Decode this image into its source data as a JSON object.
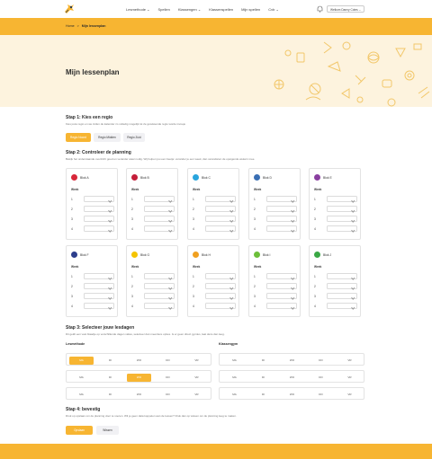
{
  "nav": {
    "items": [
      "Lesmethode ⌄",
      "Spellen",
      "Klassengen ⌄",
      "Klassenspellen",
      "Mijn spellen",
      "Cvb ⌄"
    ],
    "user_button": "Welkom Danny Cotes ⌄"
  },
  "breadcrumb": {
    "home": "Home",
    "sep": ">",
    "current": "Mijn lessenplan"
  },
  "hero": {
    "title": "Mijn lessenplan"
  },
  "step1": {
    "title": "Stap 1: Kies een regio",
    "desc": "Kies jouw regio en we zullen de kalender zo volledig mogelijk tot 2e gewissende regio worde invoeje",
    "regions": [
      "Regio Noord",
      "Regio Midden",
      "Regio Zuid"
    ],
    "active_region": 0
  },
  "step2": {
    "title": "Stap 2: Controleer de planning",
    "desc": "Bekijk het onderstaande overzicht goed en verander waar nodig. Wij helpen jou een beetje: verander je een week, dan verandaren de opeigende wekern mee.",
    "week_label": "Week",
    "weeks": [
      "1",
      "2",
      "3",
      "4"
    ],
    "blocks": [
      {
        "name": "Blok A",
        "color": "#d8283a",
        "icon": "shoe-icon"
      },
      {
        "name": "Blok B",
        "color": "#c41e3a",
        "icon": "hand-icon"
      },
      {
        "name": "Blok C",
        "color": "#29a5dd",
        "icon": "swimmer-icon"
      },
      {
        "name": "Blok D",
        "color": "#3a6fb4",
        "icon": "rings-icon"
      },
      {
        "name": "Blok E",
        "color": "#8a3fa0",
        "icon": "runner-icon"
      },
      {
        "name": "Blok F",
        "color": "#2c3e8c",
        "icon": "ball-icon"
      },
      {
        "name": "Blok G",
        "color": "#f5c400",
        "icon": "figure-icon"
      },
      {
        "name": "Blok H",
        "color": "#f0a020",
        "icon": "skate-icon"
      },
      {
        "name": "Blok I",
        "color": "#6cbf3a",
        "icon": "star-icon"
      },
      {
        "name": "Blok J",
        "color": "#3aa845",
        "icon": "horseshoe-icon"
      }
    ]
  },
  "step3": {
    "title": "Stap 3: Selecteer jouw lesdagen",
    "desc": "Dit geldt een vast blaadje op verschillende dagen valies, selecteer dan meerdere opties. Is er geen direct gymles, laat deze dan leeg.",
    "lesmethode_label": "Lesmethode",
    "klassengym_label": "Klassengym",
    "days": [
      "MA",
      "DI",
      "WO",
      "DO",
      "VR"
    ],
    "lesmethode_rows": [
      {
        "on": [
          0
        ]
      },
      {
        "on": [
          2
        ]
      },
      {
        "on": []
      }
    ],
    "klassengym_rows": [
      {
        "on": []
      },
      {
        "on": []
      },
      {
        "on": []
      }
    ]
  },
  "step4": {
    "title": "Stap 4: bevestig",
    "desc": "Druk op opslaan om de planning door te voeren. Wil je geen data koppelen aan de lessen? Druk dan op wissen om de planning leeg te maken.",
    "save_label": "Opslaan",
    "clear_label": "Wissen"
  },
  "colors": {
    "accent": "#f7b532",
    "hero_bg": "#fdf3de"
  }
}
